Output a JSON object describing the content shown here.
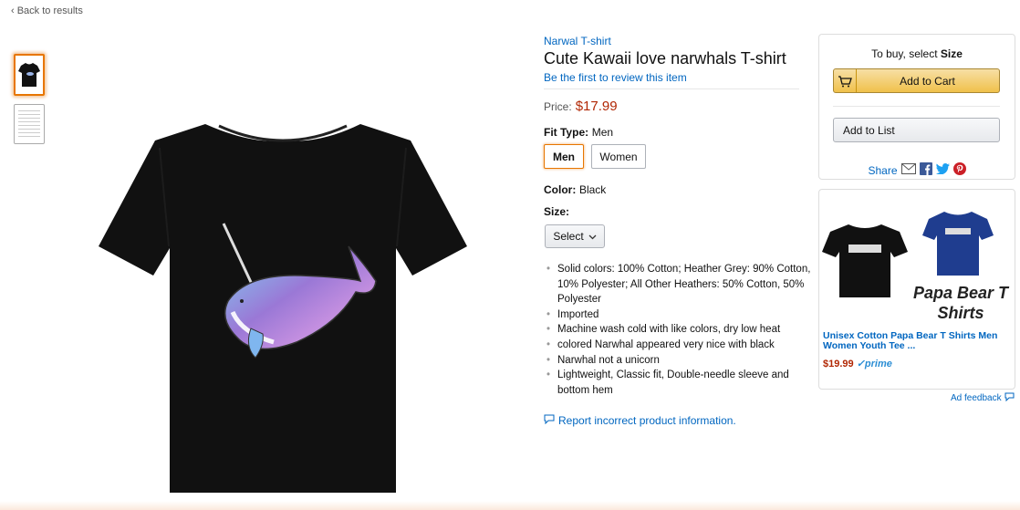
{
  "nav": {
    "back_label": "‹ Back to results"
  },
  "product": {
    "brand": "Narwal T-shirt",
    "title": "Cute Kawaii love narwhals T-shirt",
    "review_link": "Be the first to review this item",
    "price_label": "Price:",
    "price": "$17.99",
    "fit_type": {
      "label": "Fit Type:",
      "value": "Men",
      "options": [
        "Men",
        "Women"
      ],
      "selected": "Men"
    },
    "color": {
      "label": "Color:",
      "value": "Black"
    },
    "size": {
      "label": "Size:",
      "select_label": "Select"
    },
    "bullets": [
      "Solid colors: 100% Cotton; Heather Grey: 90% Cotton, 10% Polyester; All Other Heathers: 50% Cotton, 50% Polyester",
      "Imported",
      "Machine wash cold with like colors, dry low heat",
      "colored Narwhal appeared very nice with black",
      "Narwhal not a unicorn",
      "Lightweight, Classic fit, Double-needle sleeve and bottom hem"
    ],
    "report_link": "Report incorrect product information.",
    "shirt_color": "#111111"
  },
  "buybox": {
    "prompt_prefix": "To buy, select ",
    "prompt_bold": "Size",
    "add_to_cart": "Add to Cart",
    "add_to_list": "Add to List",
    "share_label": "Share",
    "share_icons": [
      "email-icon",
      "facebook-icon",
      "twitter-icon",
      "pinterest-icon"
    ]
  },
  "ad": {
    "tagline": "Papa Bear T Shirts",
    "title": "Unisex Cotton Papa Bear T Shirts Men Women Youth Tee ...",
    "price": "$19.99",
    "prime": "✓prime",
    "feedback": "Ad feedback"
  },
  "colors": {
    "accent": "#e77600",
    "link": "#0066c0",
    "price": "#b12704",
    "cart": "#f0c14b"
  }
}
